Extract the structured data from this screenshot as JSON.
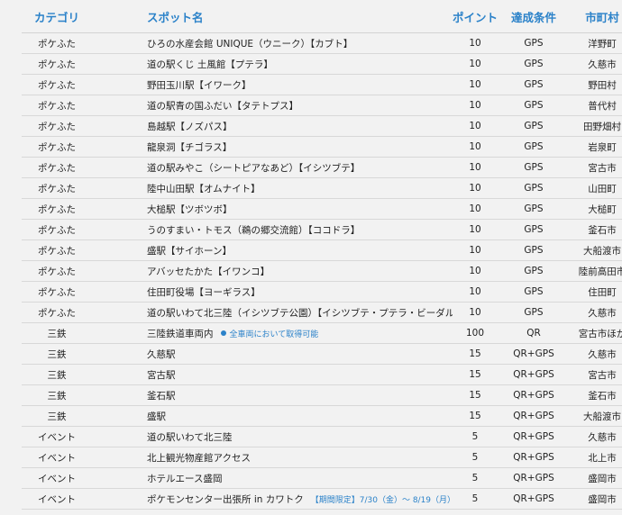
{
  "headers": {
    "category": "カテゴリ",
    "spot": "スポット名",
    "points": "ポイント",
    "condition": "達成条件",
    "city": "市町村"
  },
  "rows": [
    {
      "category": "ポケふた",
      "spot": "ひろの水産会館 UNIQUE（ウニーク）【カブト】",
      "note": "",
      "points": "10",
      "condition": "GPS",
      "city": "洋野町"
    },
    {
      "category": "ポケふた",
      "spot": "道の駅くじ 土風館【プテラ】",
      "note": "",
      "points": "10",
      "condition": "GPS",
      "city": "久慈市"
    },
    {
      "category": "ポケふた",
      "spot": "野田玉川駅【イワーク】",
      "note": "",
      "points": "10",
      "condition": "GPS",
      "city": "野田村"
    },
    {
      "category": "ポケふた",
      "spot": "道の駅青の国ふだい【タテトプス】",
      "note": "",
      "points": "10",
      "condition": "GPS",
      "city": "普代村"
    },
    {
      "category": "ポケふた",
      "spot": "島越駅【ノズパス】",
      "note": "",
      "points": "10",
      "condition": "GPS",
      "city": "田野畑村"
    },
    {
      "category": "ポケふた",
      "spot": "龍泉洞【チゴラス】",
      "note": "",
      "points": "10",
      "condition": "GPS",
      "city": "岩泉町"
    },
    {
      "category": "ポケふた",
      "spot": "道の駅みやこ（シートピアなあど）【イシツブテ】",
      "note": "",
      "points": "10",
      "condition": "GPS",
      "city": "宮古市"
    },
    {
      "category": "ポケふた",
      "spot": "陸中山田駅【オムナイト】",
      "note": "",
      "points": "10",
      "condition": "GPS",
      "city": "山田町"
    },
    {
      "category": "ポケふた",
      "spot": "大槌駅【ツボツボ】",
      "note": "",
      "points": "10",
      "condition": "GPS",
      "city": "大槌町"
    },
    {
      "category": "ポケふた",
      "spot": "うのすまい・トモス（鵜の郷交流館）【ココドラ】",
      "note": "",
      "points": "10",
      "condition": "GPS",
      "city": "釜石市"
    },
    {
      "category": "ポケふた",
      "spot": "盛駅【サイホーン】",
      "note": "",
      "points": "10",
      "condition": "GPS",
      "city": "大船渡市"
    },
    {
      "category": "ポケふた",
      "spot": "アバッセたかた【イワンコ】",
      "note": "",
      "points": "10",
      "condition": "GPS",
      "city": "陸前高田市"
    },
    {
      "category": "ポケふた",
      "spot": "住田町役場【ヨーギラス】",
      "note": "",
      "points": "10",
      "condition": "GPS",
      "city": "住田町"
    },
    {
      "category": "ポケふた",
      "spot": "道の駅いわて北三陸（イシツブテ公園）【イシツブテ・プテラ・ビーダル】",
      "note": "",
      "points": "10",
      "condition": "GPS",
      "city": "久慈市"
    },
    {
      "category": "三鉄",
      "spot": "三陸鉄道車両内",
      "note": "全車両において取得可能",
      "points": "100",
      "condition": "QR",
      "city": "宮古市ほか"
    },
    {
      "category": "三鉄",
      "spot": "久慈駅",
      "note": "",
      "points": "15",
      "condition": "QR+GPS",
      "city": "久慈市"
    },
    {
      "category": "三鉄",
      "spot": "宮古駅",
      "note": "",
      "points": "15",
      "condition": "QR+GPS",
      "city": "宮古市"
    },
    {
      "category": "三鉄",
      "spot": "釜石駅",
      "note": "",
      "points": "15",
      "condition": "QR+GPS",
      "city": "釜石市"
    },
    {
      "category": "三鉄",
      "spot": "盛駅",
      "note": "",
      "points": "15",
      "condition": "QR+GPS",
      "city": "大船渡市"
    },
    {
      "category": "イベント",
      "spot": "道の駅いわて北三陸",
      "note": "",
      "points": "5",
      "condition": "QR+GPS",
      "city": "久慈市"
    },
    {
      "category": "イベント",
      "spot": "北上観光物産館アクセス",
      "note": "",
      "points": "5",
      "condition": "QR+GPS",
      "city": "北上市"
    },
    {
      "category": "イベント",
      "spot": "ホテルエース盛岡",
      "note": "",
      "points": "5",
      "condition": "QR+GPS",
      "city": "盛岡市"
    },
    {
      "category": "イベント",
      "spot": "ポケモンセンター出張所 in カワトク",
      "note": "【期間限定】7/30（金）～ 8/19（月）",
      "points": "5",
      "condition": "QR+GPS",
      "city": "盛岡市"
    }
  ]
}
